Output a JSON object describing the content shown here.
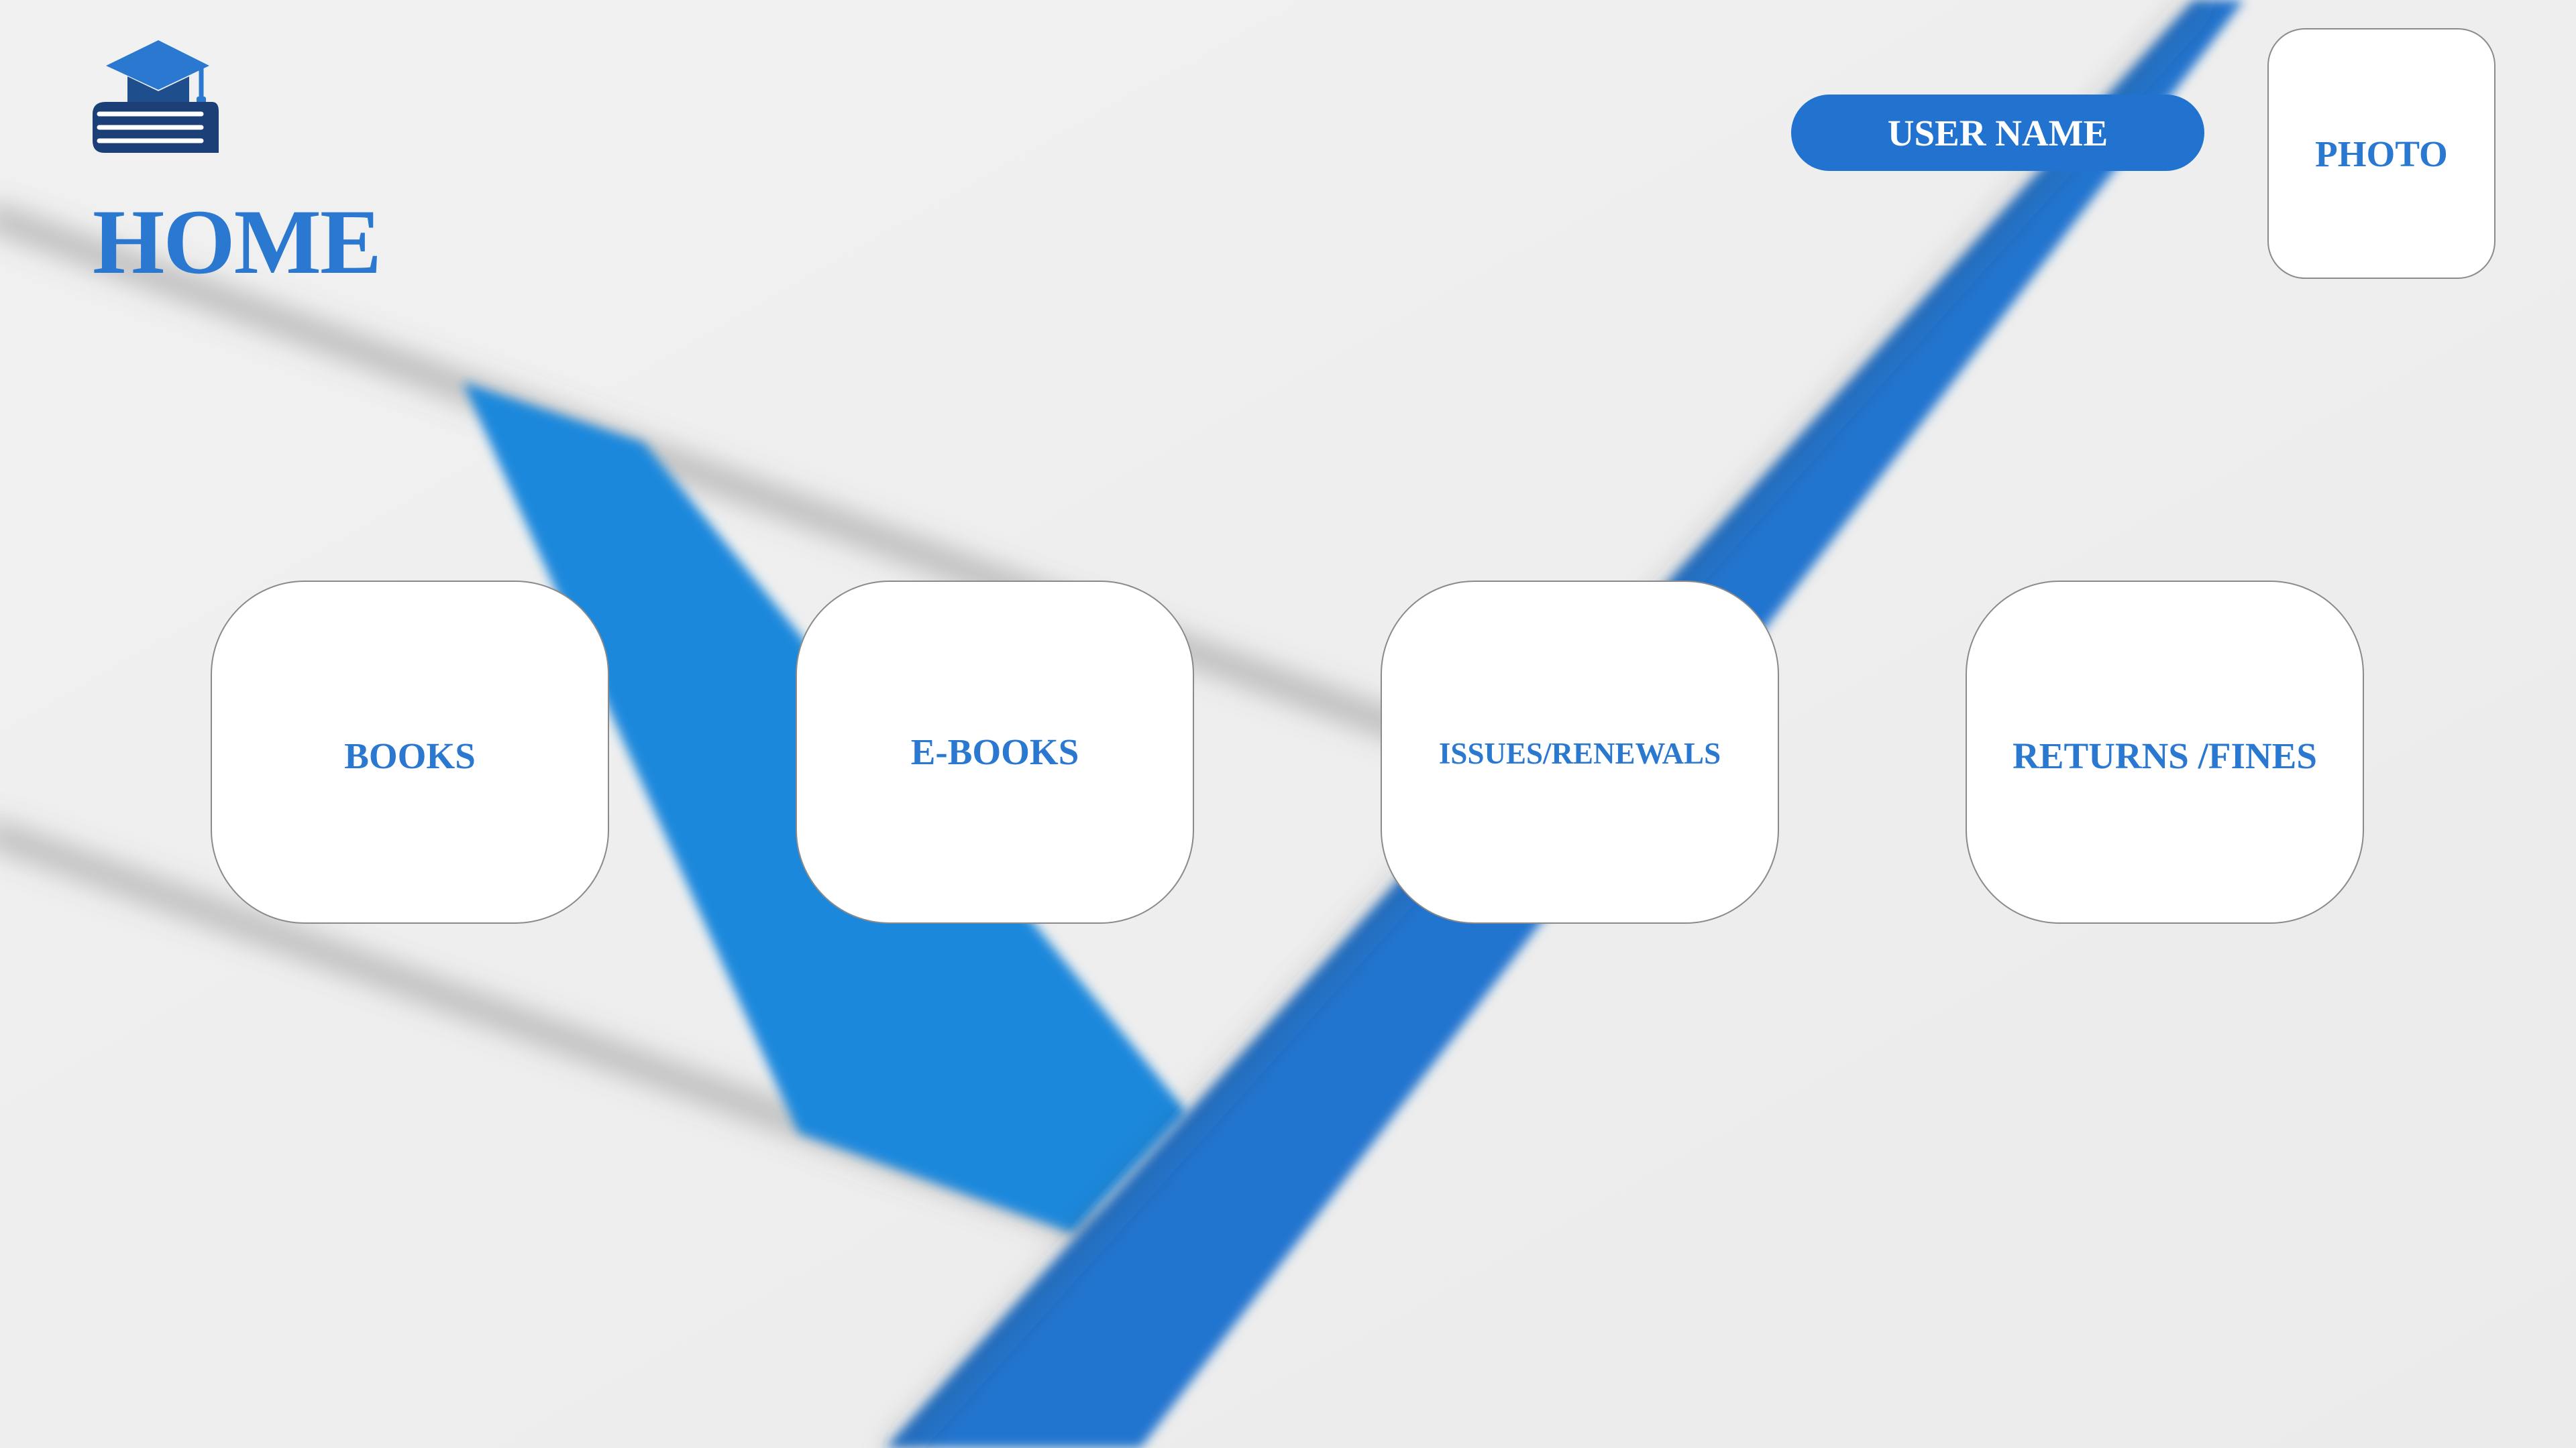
{
  "header": {
    "page_title": "HOME",
    "logo_icon": "graduation-cap-books-icon",
    "user_name_label": "USER NAME",
    "photo_label": "PHOTO"
  },
  "menu": {
    "books_label": "BOOKS",
    "ebooks_label": "E-BOOKS",
    "issues_label": "ISSUES/RENEWALS",
    "returns_label": "RETURNS /FINES"
  },
  "colors": {
    "accent": "#2a78d0",
    "pill_background": "#2272cf",
    "background": "#eeeeee",
    "tile_background": "#ffffff"
  }
}
